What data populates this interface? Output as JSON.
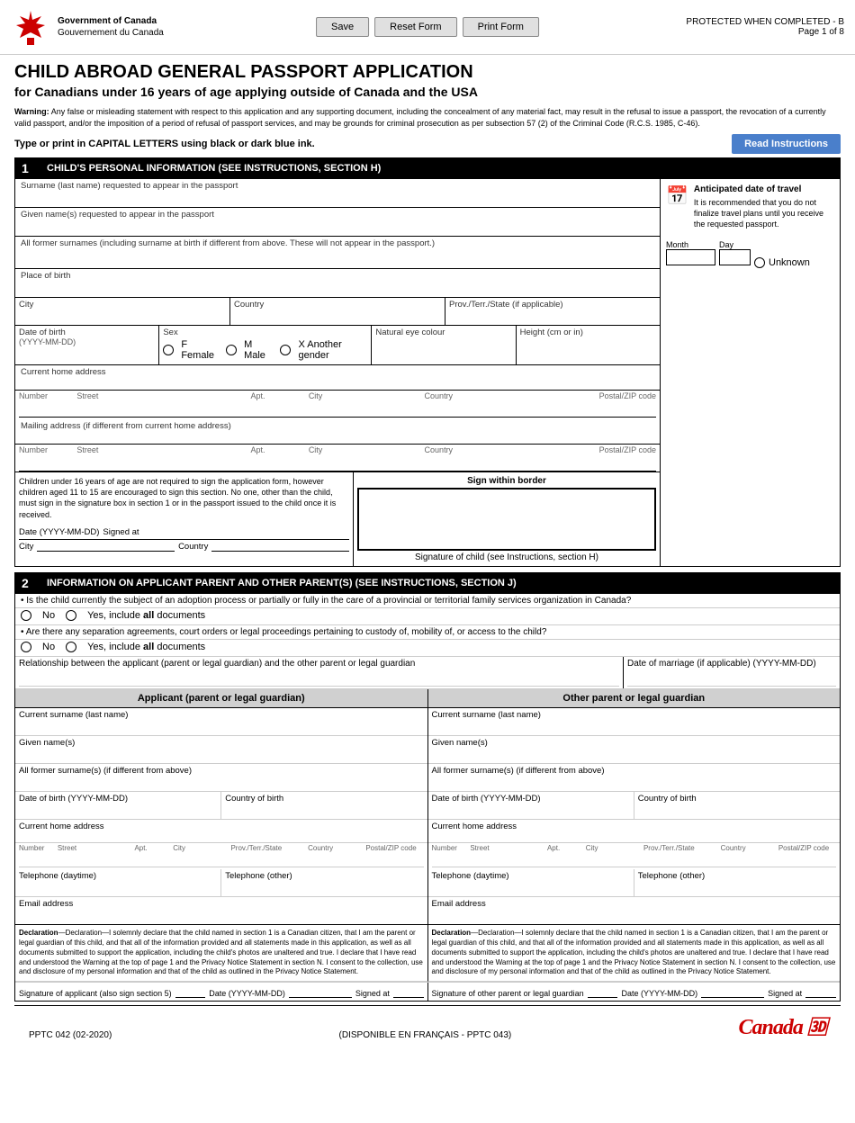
{
  "header": {
    "govt_en": "Government\nof Canada",
    "govt_fr": "Gouvernement\ndu Canada",
    "protected": "PROTECTED WHEN COMPLETED - B",
    "page": "Page 1 of 8",
    "buttons": {
      "save": "Save",
      "reset": "Reset Form",
      "print": "Print Form"
    }
  },
  "form": {
    "title": "CHILD ABROAD GENERAL PASSPORT APPLICATION",
    "subtitle": "for Canadians under 16 years of age applying outside of Canada and the USA",
    "warning": "Warning: Any false or misleading statement with respect to this application and any supporting document, including the concealment of any material fact, may result in the refusal to issue a passport, the revocation of a currently valid passport, and/or the imposition of a period of refusal of passport services, and may be grounds for criminal prosecution as per subsection 57 (2) of the Criminal Code (R.C.S. 1985, C-46).",
    "instruction_bar": "Type or print in CAPITAL LETTERS using black or dark blue ink.",
    "read_instructions": "Read Instructions"
  },
  "section1": {
    "number": "1",
    "title": "CHILD'S PERSONAL INFORMATION (SEE INSTRUCTIONS, SECTION H)",
    "fields": {
      "surname_label": "Surname (last name) requested to appear in the passport",
      "given_name_label": "Given name(s) requested to appear in the passport",
      "former_surnames_label": "All former surnames (including surname at birth if different from above. These will not appear in the passport.)",
      "place_of_birth_label": "Place of birth",
      "city_label": "City",
      "country_label": "Country",
      "prov_state_label": "Prov./Terr./State (if applicable)",
      "dob_label": "Date of birth",
      "dob_format": "(YYYY-MM-DD)",
      "sex_label": "Sex",
      "sex_f": "F  Female",
      "sex_m": "M  Male",
      "sex_x": "X  Another gender",
      "eye_colour_label": "Natural eye colour",
      "height_label": "Height (cm or in)",
      "home_address_label": "Current home address",
      "number_label": "Number",
      "street_label": "Street",
      "apt_label": "Apt.",
      "city2_label": "City",
      "country2_label": "Country",
      "postal_label": "Postal/ZIP code",
      "mailing_address_label": "Mailing address (if different from current home address)"
    },
    "travel_date": {
      "title": "Anticipated date of travel",
      "note": "It is recommended that you do not finalize travel plans until you receive the requested passport.",
      "month_label": "Month",
      "day_label": "Day",
      "unknown_label": "Unknown"
    },
    "signature": {
      "desc_text": "Children under 16 years of age are not required to sign the application form, however children aged 11 to 15 are encouraged to sign this section. No one, other than the child, must sign in the signature box in section 1 or in the passport issued to the child once it is received.",
      "date_label": "Date (YYYY-MM-DD)",
      "signed_at_label": "Signed at",
      "city_label": "City",
      "country_label": "Country",
      "sign_within_border": "Sign within border",
      "sig_child_label": "Signature of child (see Instructions, section H)"
    }
  },
  "section2": {
    "number": "2",
    "title": "INFORMATION ON APPLICANT PARENT AND OTHER PARENT(S) (SEE INSTRUCTIONS, SECTION J)",
    "q1": "• Is the child currently the subject of an adoption process or partially or fully in the care of a provincial or territorial family services organization in Canada?",
    "q1_no": "No",
    "q1_yes": "Yes, include all documents",
    "q2": "• Are there any separation agreements, court orders or legal proceedings pertaining to custody of, mobility of, or access to the child?",
    "q2_no": "No",
    "q2_yes": "Yes, include all documents",
    "relationship_label": "Relationship between the applicant (parent or legal guardian) and the other parent or legal guardian",
    "marriage_date_label": "Date of marriage (if applicable) (YYYY-MM-DD)",
    "applicant_header": "Applicant (parent or legal guardian)",
    "other_parent_header": "Other parent or legal guardian",
    "applicant": {
      "surname_label": "Current surname (last name)",
      "given_names_label": "Given name(s)",
      "former_surnames_label": "All former surname(s) (if different from above)",
      "dob_label": "Date of birth (YYYY-MM-DD)",
      "country_of_birth_label": "Country of birth",
      "home_address_label": "Current home address",
      "addr_labels": "Number  Street    Apt.  City                    Prov./Terr./State          Country     Postal/ZIP code",
      "telephone_daytime_label": "Telephone (daytime)",
      "telephone_other_label": "Telephone (other)",
      "email_label": "Email address"
    },
    "other_parent": {
      "surname_label": "Current surname (last name)",
      "given_names_label": "Given name(s)",
      "former_surnames_label": "All former surname(s) (if different from above)",
      "dob_label": "Date of birth (YYYY-MM-DD)",
      "country_of_birth_label": "Country of birth",
      "home_address_label": "Current home address",
      "telephone_daytime_label": "Telephone (daytime)",
      "telephone_other_label": "Telephone (other)",
      "email_label": "Email address"
    },
    "declaration": "Declaration—I solemnly declare that the child named in section 1 is a Canadian citizen, that I am the parent or legal guardian of this child, and that all of the information provided and all statements made in this application, as well as all documents submitted to support the application, including the child's photos are unaltered and true. I declare that I have read and understood the Warning at the top of page 1 and the Privacy Notice Statement in section N. I consent to the collection, use and disclosure of my personal information and that of the child as outlined in the Privacy Notice Statement.",
    "signature_applicant_label": "Signature of applicant (also sign section 5)",
    "signature_other_label": "Signature of other parent or legal guardian",
    "date_label": "Date (YYYY-MM-DD)",
    "signed_at_label": "Signed at"
  },
  "footer": {
    "form_number": "PPTC 042 (02-2020)",
    "french": "(DISPONIBLE EN FRANÇAIS - PPTC 043)",
    "canada_wordmark": "Canada"
  }
}
